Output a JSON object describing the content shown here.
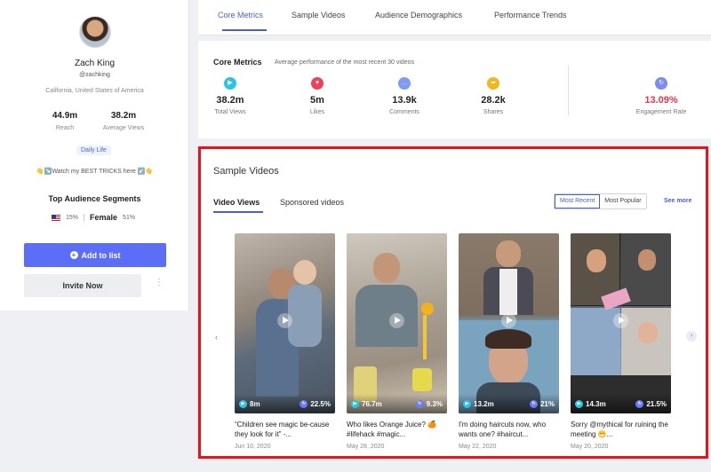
{
  "profile": {
    "name": "Zach King",
    "handle": "@zachking",
    "location": "California, United States of America",
    "reach_value": "44.9m",
    "reach_label": "Reach",
    "avg_views_value": "38.2m",
    "avg_views_label": "Average Views",
    "tag": "Daily Life",
    "bio": "👋↘️Watch my BEST TRICKS here ↙️👋",
    "segments_title": "Top Audience Segments",
    "segment_country_pct": "15%",
    "segment_gender": "Female",
    "segment_gender_pct": "51%",
    "add_to_list": "Add to list",
    "invite_now": "Invite Now",
    "more_icon": "⋮"
  },
  "tabs": [
    {
      "label": "Core Metrics",
      "active": true
    },
    {
      "label": "Sample Videos",
      "active": false
    },
    {
      "label": "Audience Demographics",
      "active": false
    },
    {
      "label": "Performance Trends",
      "active": false
    }
  ],
  "core_metrics": {
    "title": "Core Metrics",
    "subtitle": "Average performance of the most recent 30 videos",
    "items": [
      {
        "value": "38.2m",
        "label": "Total Views",
        "icon": "play-icon",
        "color": "#2bc4e8"
      },
      {
        "value": "5m",
        "label": "Likes",
        "icon": "heart-icon",
        "color": "#f0405a"
      },
      {
        "value": "13.9k",
        "label": "Comments",
        "icon": "comment-icon",
        "color": "#7d9bf2"
      },
      {
        "value": "28.2k",
        "label": "Shares",
        "icon": "share-icon",
        "color": "#f5b51e"
      }
    ],
    "engagement": {
      "value": "13.09%",
      "label": "Engagement Rate",
      "icon": "refresh-icon",
      "color": "#7d8bf5"
    }
  },
  "sample_videos": {
    "title": "Sample Videos",
    "tabs": [
      "Video Views",
      "Sponsored videos"
    ],
    "sort": [
      "Most Recent",
      "Most Popular"
    ],
    "see_more": "See more",
    "videos": [
      {
        "views": "8m",
        "engagement": "22.5%",
        "caption": "“Children see magic be-cause they look for it” -...",
        "date": "Jun 10, 2020"
      },
      {
        "views": "76.7m",
        "engagement": "9.3%",
        "caption": "Who likes Orange Juice? 🍊 #lifehack #magic...",
        "date": "May 28, 2020"
      },
      {
        "views": "13.2m",
        "engagement": "21%",
        "caption": "I'm doing haircuts now, who wants one? #haircut...",
        "date": "May 22, 2020"
      },
      {
        "views": "14.3m",
        "engagement": "21.5%",
        "caption": "Sorry @mythical for ruining the meeting 😬...",
        "date": "May 20, 2020"
      }
    ]
  }
}
